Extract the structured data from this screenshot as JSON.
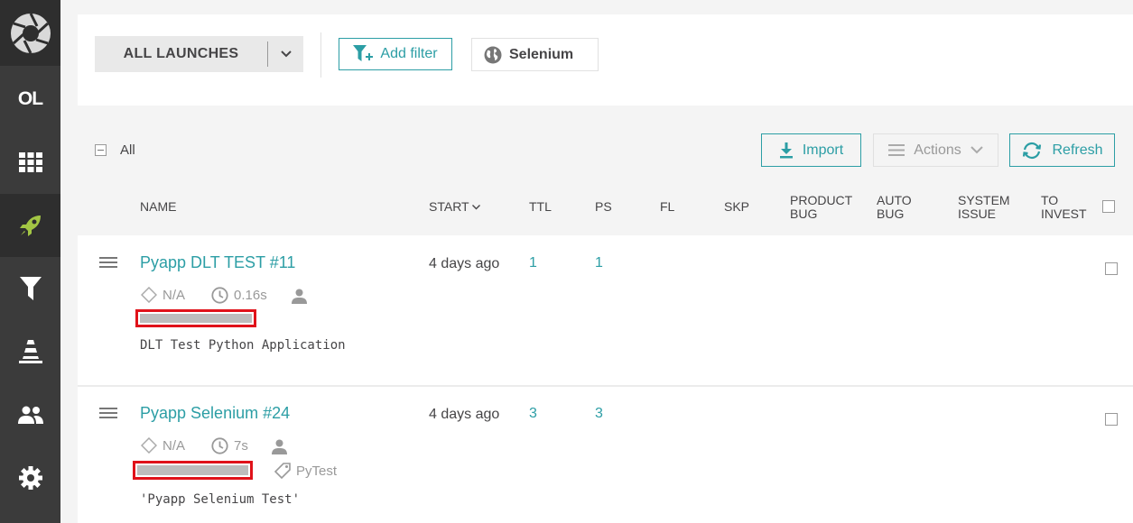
{
  "sidebar": {
    "project": "OL",
    "icons": [
      "logo-icon",
      "dashboard-icon",
      "launches-icon",
      "filters-icon",
      "debug-icon",
      "members-icon",
      "settings-icon"
    ]
  },
  "filterbar": {
    "launches_select": "ALL LAUNCHES",
    "add_filter": "Add filter",
    "filter_chip": "Selenium"
  },
  "toolbar": {
    "all_label": "All",
    "import_label": "Import",
    "actions_label": "Actions",
    "refresh_label": "Refresh"
  },
  "columns": {
    "name": "NAME",
    "start": "START",
    "ttl": "TTL",
    "ps": "PS",
    "fl": "FL",
    "skp": "SKP",
    "product_bug_1": "PRODUCT",
    "product_bug_2": "BUG",
    "auto_bug_1": "AUTO",
    "auto_bug_2": "BUG",
    "system_issue_1": "SYSTEM",
    "system_issue_2": "ISSUE",
    "to_invest_1": "TO",
    "to_invest_2": "INVEST"
  },
  "launches": [
    {
      "name": "Pyapp DLT TEST #11",
      "start": "4 days ago",
      "ttl": "1",
      "ps": "1",
      "status": "N/A",
      "duration": "0.16s",
      "tag": "",
      "description": "DLT Test Python Application"
    },
    {
      "name": "Pyapp Selenium #24",
      "start": "4 days ago",
      "ttl": "3",
      "ps": "3",
      "status": "N/A",
      "duration": "7s",
      "tag": "PyTest",
      "description": "'Pyapp Selenium Test'"
    }
  ],
  "colors": {
    "accent": "#2c9ea5",
    "sidebar_bg": "#3b3b3b",
    "active_icon": "#a3c644",
    "redaction": "#e0121a"
  }
}
